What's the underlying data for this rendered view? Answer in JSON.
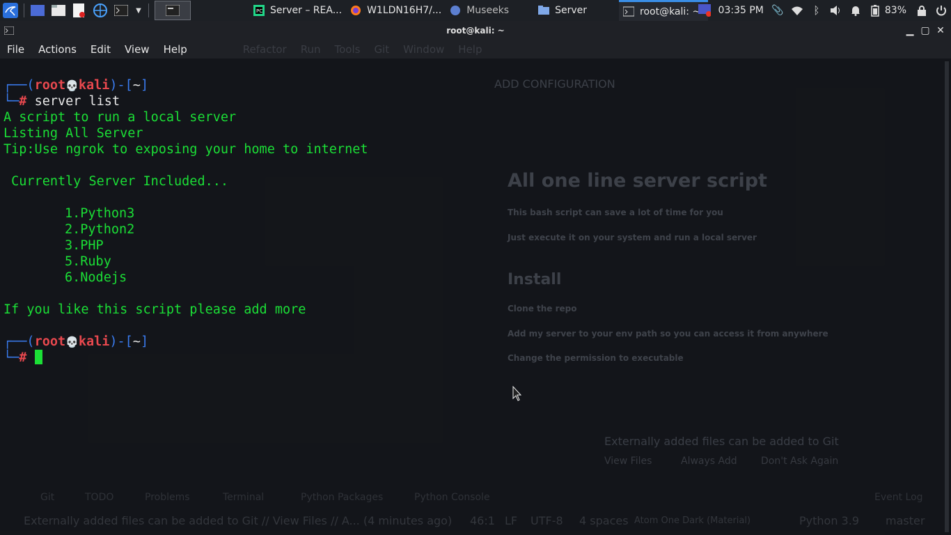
{
  "taskbar": {
    "tasks": [
      {
        "label": "Server – REA..."
      },
      {
        "label": "W1LDN16H7/..."
      },
      {
        "label": "Museeks"
      },
      {
        "label": "Server"
      },
      {
        "label": "root@kali: ~"
      }
    ],
    "clock": "03:35 PM",
    "battery": "83%"
  },
  "window": {
    "title": "root@kali: ~",
    "menu": [
      "File",
      "Actions",
      "Edit",
      "View",
      "Help"
    ]
  },
  "prompt": {
    "open": "┌──(",
    "user": "root",
    "skull": "💀",
    "host": "kali",
    "mid": ")-[",
    "dir": "~",
    "close": "]",
    "arrow": "└─",
    "hash": "#"
  },
  "terminal": {
    "command": "server list",
    "output": [
      "A script to run a local server",
      "Listing All Server",
      "Tip:Use ngrok to exposing your home to internet",
      " Currently Server Included...",
      "1.Python3",
      "2.Python2",
      "3.PHP",
      "5.Ruby",
      "6.Nodejs",
      "If you like this script please add more"
    ]
  },
  "background_ide": {
    "menu": [
      "Refactor",
      "Run",
      "Tools",
      "Git",
      "Window",
      "Help"
    ],
    "config_button": "ADD CONFIGURATION",
    "heading": "All one line server script",
    "line1": "This bash script can save a lot of time for you",
    "line2": "Just execute it on your system and run a local server",
    "install": "Install",
    "clone": "Clone the repo",
    "addpath": "Add my server to your env path so you can access it from anywhere",
    "perm": "Change the permission to executable",
    "notice": "Externally added files can be added to Git",
    "notice_actions": [
      "View Files",
      "Always Add",
      "Don't Ask Again"
    ],
    "bottom_tabs": [
      "Git",
      "TODO",
      "Problems",
      "Terminal",
      "Python Packages",
      "Python Console",
      "Event Log"
    ],
    "status_msg": "Externally added files can be added to Git // View Files // A... (4 minutes ago)",
    "status_right": [
      "46:1",
      "LF",
      "UTF-8",
      "4 spaces",
      "Atom One Dark (Material)",
      "Python 3.9",
      "master"
    ]
  },
  "colors": {
    "green": "#1bdf36",
    "blue": "#3a7cf0",
    "red": "#e8484e"
  }
}
